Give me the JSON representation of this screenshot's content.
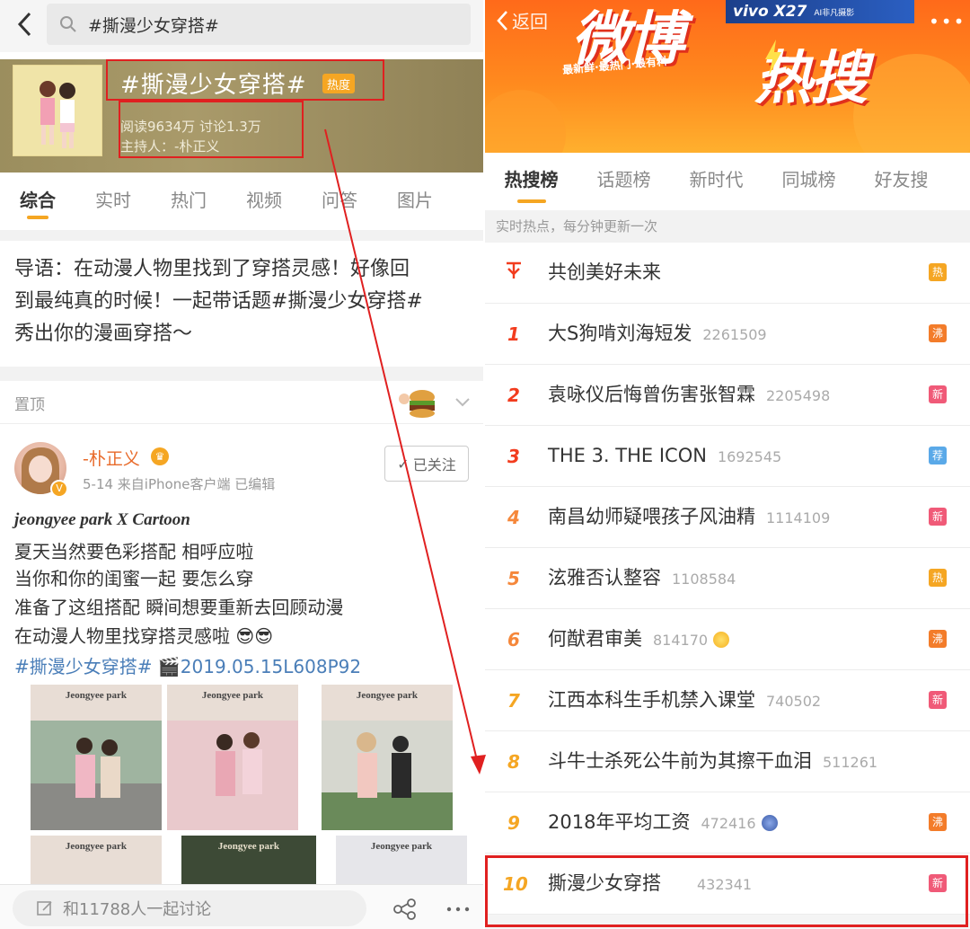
{
  "left": {
    "search_query": "#撕漫少女穿搭#",
    "topic": {
      "title": "#撕漫少女穿搭#",
      "hot_badge": "热度",
      "stats": "阅读9634万  讨论1.3万",
      "host": "主持人：-朴正义"
    },
    "tabs": [
      "综合",
      "实时",
      "热门",
      "视频",
      "问答",
      "图片"
    ],
    "intro_lines": [
      "导语：在动漫人物里找到了穿搭灵感！好像回",
      "到最纯真的时候！一起带话题#撕漫少女穿搭#",
      "秀出你的漫画穿搭～"
    ],
    "pinned_label": "置顶",
    "post": {
      "author": "-朴正义",
      "meta": "5-14  来自iPhone客户端  已编辑",
      "follow_label": "已关注",
      "lines": [
        "jeongyee park X Cartoon",
        "夏天当然要色彩搭配 相呼应啦",
        "当你和你的闺蜜一起 要怎么穿",
        "准备了这组搭配 瞬间想要重新去回顾动漫",
        "在动漫人物里找穿搭灵感啦 😎😎",
        "#撕漫少女穿搭# 🎬2019.05.15L608P92"
      ],
      "photo_title": "Jeongyee park"
    },
    "comment_placeholder": "和11788人一起讨论"
  },
  "right": {
    "back_label": "返回",
    "banner_title_1": "微博",
    "banner_title_2": "热搜",
    "slogan": "最新鲜·最热门·最有料",
    "ad_brand": "vivo X27",
    "ad_sub": "AI非凡摄影",
    "tabs": [
      "热搜榜",
      "话题榜",
      "新时代",
      "同城榜",
      "好友搜"
    ],
    "subtitle": "实时热点，每分钟更新一次",
    "items": [
      {
        "rank": "",
        "title": "共创美好未来",
        "count": "",
        "tag": "热",
        "tag_color": "#f5a623"
      },
      {
        "rank": "1",
        "title": "大S狗啃刘海短发",
        "count": "2261509",
        "tag": "沸",
        "tag_color": "#f37c2a"
      },
      {
        "rank": "2",
        "title": "袁咏仪后悔曾伤害张智霖",
        "count": "2205498",
        "tag": "新",
        "tag_color": "#f05a78"
      },
      {
        "rank": "3",
        "title": "THE 3. THE ICON",
        "count": "1692545",
        "tag": "荐",
        "tag_color": "#5aa9e8"
      },
      {
        "rank": "4",
        "title": "南昌幼师疑喂孩子风油精",
        "count": "1114109",
        "tag": "新",
        "tag_color": "#f05a78"
      },
      {
        "rank": "5",
        "title": "泫雅否认整容",
        "count": "1108584",
        "tag": "热",
        "tag_color": "#f5a623"
      },
      {
        "rank": "6",
        "title": "何猷君审美",
        "count": "814170",
        "tag": "沸",
        "tag_color": "#f37c2a"
      },
      {
        "rank": "7",
        "title": "江西本科生手机禁入课堂",
        "count": "740502",
        "tag": "新",
        "tag_color": "#f05a78"
      },
      {
        "rank": "8",
        "title": "斗牛士杀死公牛前为其擦干血泪",
        "count": "511261",
        "tag": "",
        "tag_color": ""
      },
      {
        "rank": "9",
        "title": "2018年平均工资",
        "count": "472416",
        "tag": "沸",
        "tag_color": "#f37c2a"
      },
      {
        "rank": "10",
        "title": "撕漫少女穿搭",
        "count": "432341",
        "tag": "新",
        "tag_color": "#f05a78"
      }
    ]
  },
  "colors": {
    "accent": "#f5a623",
    "highlight": "#e02020",
    "link": "#4a7eb8"
  }
}
